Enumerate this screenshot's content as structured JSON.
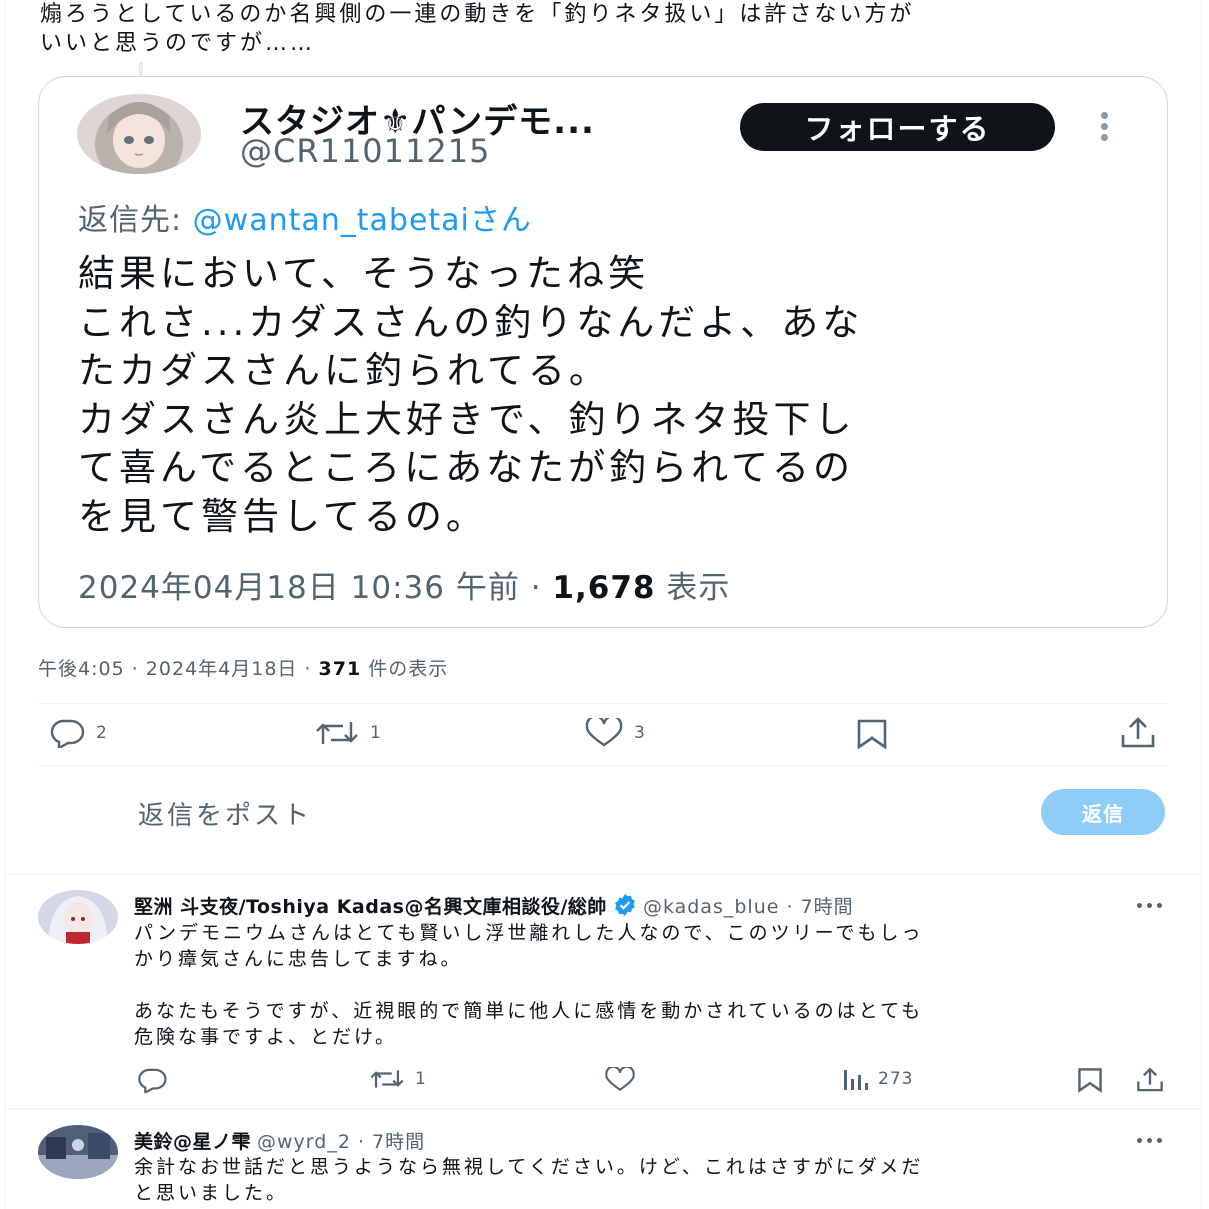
{
  "main_post": {
    "text_lines": [
      "煽ろうとしているのか名興側の一連の動きを「釣りネタ扱い」は許さない方が",
      "いいと思うのですが……"
    ],
    "meta_time": "午後4:05",
    "meta_date": "2024年4月18日",
    "meta_views_count": "371",
    "meta_views_label": "件の表示",
    "actions": {
      "replies": "2",
      "reposts": "1",
      "likes": "3"
    }
  },
  "quote": {
    "name": "スタジオ⚜パンデモ...",
    "handle": "@CR11011215",
    "follow_label": "フォローする",
    "reply_to_prefix": "返信先: ",
    "reply_to_mention": "@wantan_tabetaiさん",
    "body_lines": [
      "結果において、そうなったね笑",
      "これさ...カダスさんの釣りなんだよ、あな",
      "たカダスさんに釣られてる。",
      "カダスさん炎上大好きで、釣りネタ投下し",
      "て喜んでるところにあなたが釣られてるの",
      "を見て警告してるの。"
    ],
    "timestamp": "2024年04月18日 10:36 午前",
    "views_count": "1,678",
    "views_label": "表示"
  },
  "composer": {
    "placeholder": "返信をポスト",
    "button_label": "返信"
  },
  "replies": [
    {
      "name": "堅洲 斗支夜/Toshiya Kadas@名興文庫相談役/総帥",
      "handle": "@kadas_blue · 7時間",
      "verified": true,
      "text_lines": [
        "パンデモニウムさんはとても賢いし浮世離れした人なので、このツリーでもしっ",
        "かり瘴気さんに忠告してますね。",
        "",
        "あなたもそうですが、近視眼的で簡単に他人に感情を動かされているのはとても",
        "危険な事ですよ、とだけ。"
      ],
      "reposts": "1",
      "views": "273"
    },
    {
      "name": "美鈴@星ノ雫",
      "handle": "@wyrd_2 · 7時間",
      "verified": false,
      "text_lines": [
        "余計なお世話だと思うようなら無視してください。けど、これはさすがにダメだ",
        "と思いました。"
      ]
    }
  ],
  "colors": {
    "text": "#0f1419",
    "secondary": "#536471",
    "accent": "#1d9bf0",
    "reply_button_disabled": "#8ecdf7",
    "border": "#cfd9de"
  }
}
